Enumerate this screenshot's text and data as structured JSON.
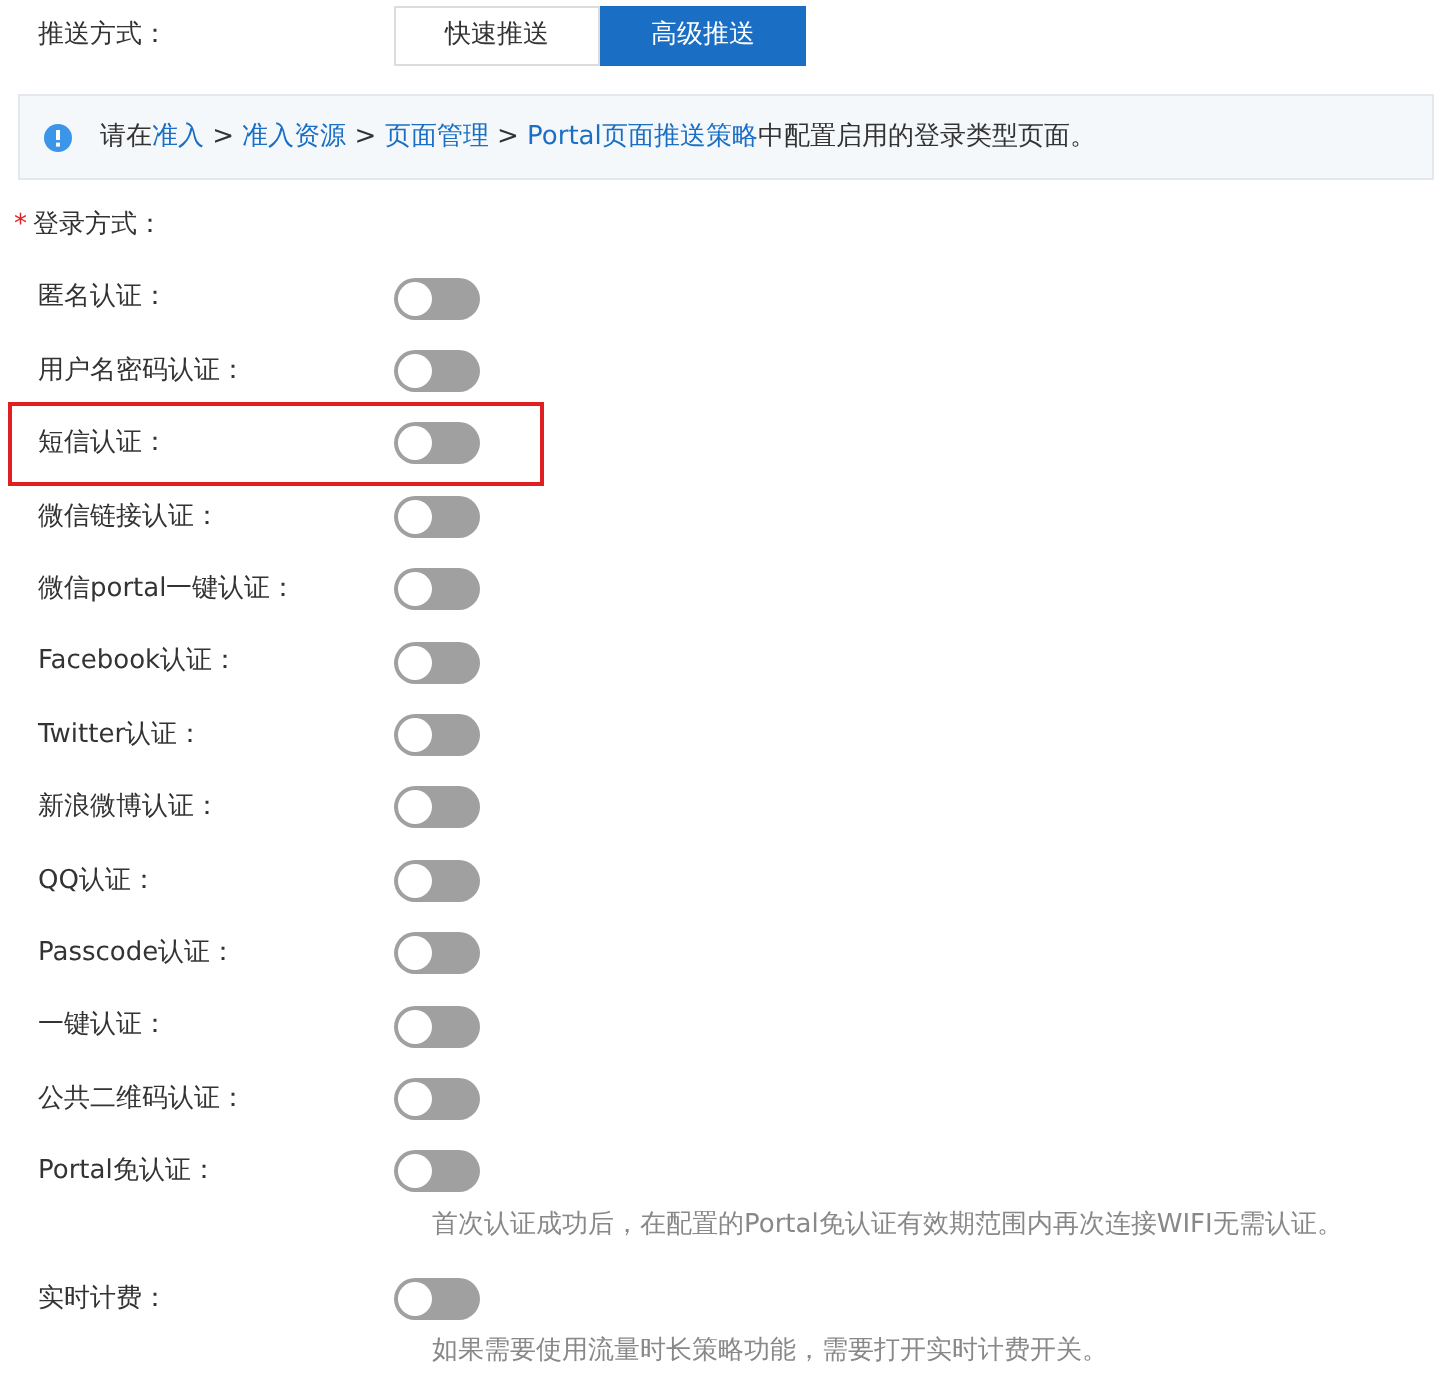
{
  "push_mode": {
    "label": "推送方式：",
    "options": [
      {
        "label": "快速推送",
        "selected": false
      },
      {
        "label": "高级推送",
        "selected": true
      }
    ]
  },
  "info": {
    "parts": [
      {
        "kind": "text",
        "text": "请在"
      },
      {
        "kind": "link",
        "text": "准入"
      },
      {
        "kind": "text",
        "text": " > "
      },
      {
        "kind": "link",
        "text": "准入资源"
      },
      {
        "kind": "text",
        "text": " > "
      },
      {
        "kind": "link",
        "text": "页面管理"
      },
      {
        "kind": "text",
        "text": " > "
      },
      {
        "kind": "link",
        "text": "Portal页面推送策略"
      },
      {
        "kind": "text",
        "text": "中配置启用的登录类型页面。"
      }
    ]
  },
  "login_methods": {
    "label": "登录方式：",
    "required_mark": "*",
    "items": [
      {
        "label": "匿名认证：",
        "on": false,
        "highlighted": false
      },
      {
        "label": "用户名密码认证：",
        "on": false,
        "highlighted": false
      },
      {
        "label": "短信认证：",
        "on": false,
        "highlighted": true
      },
      {
        "label": "微信链接认证：",
        "on": false,
        "highlighted": false
      },
      {
        "label": "微信portal一键认证：",
        "on": false,
        "highlighted": false
      },
      {
        "label": "Facebook认证：",
        "on": false,
        "highlighted": false
      },
      {
        "label": "Twitter认证：",
        "on": false,
        "highlighted": false
      },
      {
        "label": "新浪微博认证：",
        "on": false,
        "highlighted": false
      },
      {
        "label": "QQ认证：",
        "on": false,
        "highlighted": false
      },
      {
        "label": "Passcode认证：",
        "on": false,
        "highlighted": false
      },
      {
        "label": "一键认证：",
        "on": false,
        "highlighted": false
      },
      {
        "label": "公共二维码认证：",
        "on": false,
        "highlighted": false
      },
      {
        "label": "Portal免认证：",
        "on": false,
        "highlighted": false,
        "hint": "首次认证成功后，在配置的Portal免认证有效期范围内再次连接WIFI无需认证。"
      },
      {
        "label": "实时计费：",
        "on": false,
        "highlighted": false,
        "hint": "如果需要使用流量时长策略功能，需要打开实时计费开关。"
      }
    ]
  }
}
